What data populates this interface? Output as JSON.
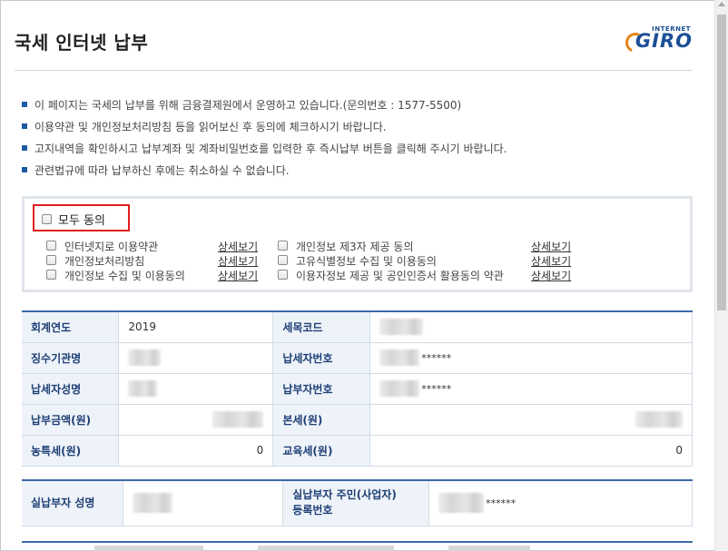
{
  "header": {
    "title": "국세 인터넷 납부",
    "logo_small": "INTERNET",
    "logo_main": "GIRO"
  },
  "notices": [
    "이 페이지는 국세의 납부를 위해 금융결제원에서 운영하고 있습니다.(문의번호 : 1577-5500)",
    "이용약관 및 개인정보처리방침 등을 읽어보신 후 동의에 체크하시기 바랍니다.",
    "고지내역을 확인하시고 납부계좌 및 계좌비밀번호를 입력한 후 즉시납부 버튼을 클릭해 주시기 바랍니다.",
    "관련법규에 따라 납부하신 후에는 취소하실 수 없습니다."
  ],
  "agreement": {
    "all_label": "모두 동의",
    "detail_link": "상세보기",
    "left_items": [
      "인터넷지로 이용약관",
      "개인정보처리방침",
      "개인정보 수집 및 이용동의"
    ],
    "right_items": [
      "개인정보 제3자 제공 동의",
      "고유식별정보 수집 및 이용동의",
      "이용자정보 제공 및 공인인증서 활용동의 약관"
    ]
  },
  "info_table": {
    "fiscal_year_label": "회계연도",
    "fiscal_year_value": "2019",
    "tax_code_label": "세목코드",
    "collector_label": "징수기관명",
    "taxpayer_no_label": "납세자번호",
    "taxpayer_no_mask": "******",
    "taxpayer_name_label": "납세자성명",
    "payer_no_label": "납부자번호",
    "payer_no_mask": "******",
    "amount_label": "납부금액(원)",
    "principal_label": "본세(원)",
    "rural_tax_label": "농특세(원)",
    "rural_tax_value": "0",
    "edu_tax_label": "교육세(원)",
    "edu_tax_value": "0"
  },
  "payer_table": {
    "name_label": "실납부자 성명",
    "id_label_line1": "실납부자 주민(사업자)",
    "id_label_line2": "등록번호",
    "id_mask": "******"
  },
  "colors": {
    "accent_blue": "#3d6aa8",
    "header_cell_bg": "#eef3f9",
    "highlight_red": "#e01e1e",
    "logo_blue": "#1b4f96",
    "logo_orange": "#e8841a"
  }
}
